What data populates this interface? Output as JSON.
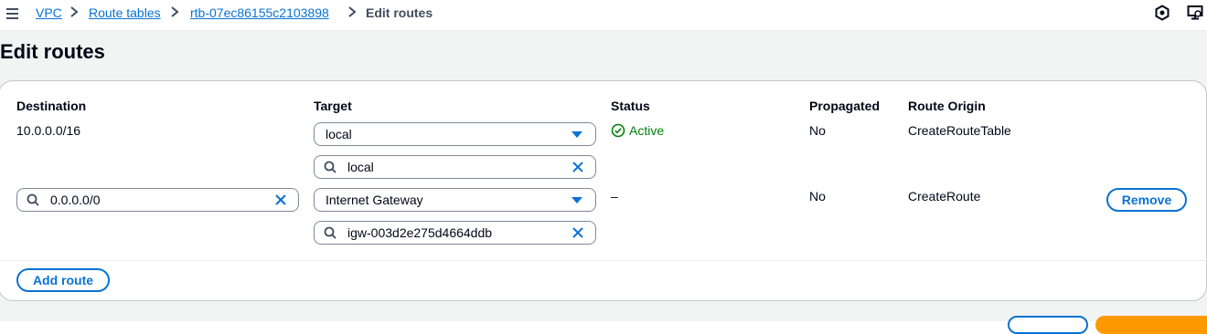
{
  "breadcrumb": {
    "items": [
      {
        "label": "VPC"
      },
      {
        "label": "Route tables"
      },
      {
        "label": "rtb-07ec86155c2103898"
      },
      {
        "label": "Edit routes"
      }
    ]
  },
  "page": {
    "title": "Edit routes"
  },
  "table": {
    "headers": {
      "destination": "Destination",
      "target": "Target",
      "status": "Status",
      "propagated": "Propagated",
      "route_origin": "Route Origin"
    },
    "rows": [
      {
        "destination": "10.0.0.0/16",
        "target_type": "local",
        "target_value": "local",
        "status": "Active",
        "propagated": "No",
        "route_origin": "CreateRouteTable"
      },
      {
        "destination": "0.0.0.0/0",
        "target_type": "Internet Gateway",
        "target_value": "igw-003d2e275d4664ddb",
        "status": "–",
        "propagated": "No",
        "route_origin": "CreateRoute",
        "remove_label": "Remove"
      }
    ]
  },
  "actions": {
    "add_route_label": "Add route"
  },
  "colors": {
    "link": "#0972d3",
    "success": "#037f0c",
    "primary": "#ff9900"
  }
}
